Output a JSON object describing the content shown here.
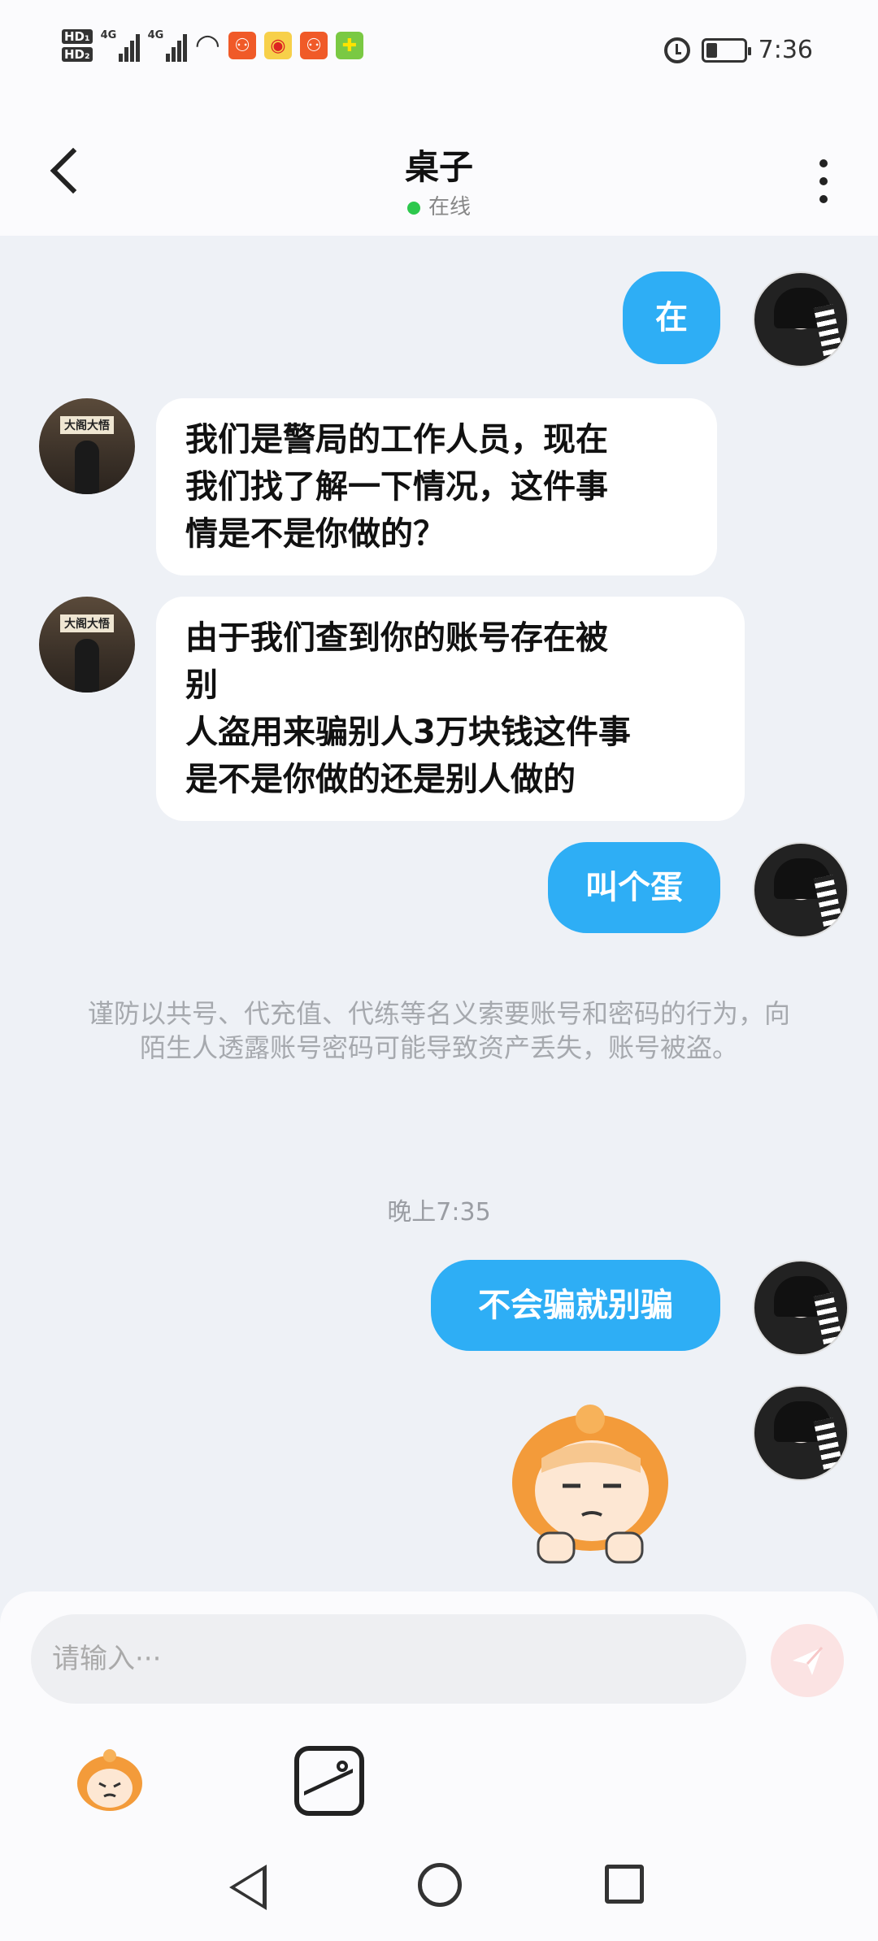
{
  "status_bar": {
    "hd1": "HD₁",
    "hd2": "HD₂",
    "net1": "4G",
    "net2": "4G",
    "time": "7:36",
    "battery_level": 0.3
  },
  "header": {
    "title": "桌子",
    "status": "在线"
  },
  "messages": [
    {
      "side": "out",
      "text": "在"
    },
    {
      "side": "in",
      "text": "我们是警局的工作人员，现在我们找了解一下情况，这件事情是不是你做的？"
    },
    {
      "side": "in",
      "text": "由于我们查到你的账号存在被别人盗用来骗别人3万块钱这件事是不是你做的还是别人做的"
    },
    {
      "side": "out",
      "text": "叫个蛋"
    },
    {
      "side": "out",
      "text": "不会骗就别骗"
    }
  ],
  "lines": {
    "m2": [
      "我们是警局的工作人员，现在",
      "我们找了解一下情况，这件事",
      "情是不是你做的？"
    ],
    "m3": [
      "由于我们查到你的账号存在被",
      "别",
      "人盗用来骗别人3万块钱这件事",
      "是不是你做的还是别人做的"
    ]
  },
  "notice": "谨防以共号、代充值、代练等名义索要账号和密码的行为，向陌生人透露账号密码可能导致资产丢失，账号被盗。",
  "timestamp": "晚上7:35",
  "avatar_other_sign": "大阁大悟",
  "input": {
    "placeholder": "请输入···"
  },
  "colors": {
    "accent": "#2eaef5",
    "online": "#2dc84d",
    "send_bg": "#fbe3e3"
  }
}
